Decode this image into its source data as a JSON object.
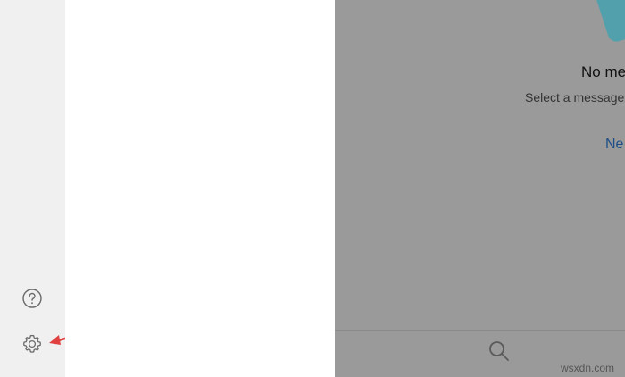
{
  "left_rail": {
    "help_icon": "help-circle-icon",
    "settings_icon": "gear-icon"
  },
  "message_pane": {
    "empty_title": "No mes",
    "empty_subtitle": "Select a message",
    "new_link": "Ne",
    "search_icon": "search-icon"
  },
  "annotation": {
    "arrow_color": "#e04040"
  },
  "watermark": "wsxdn.com",
  "colors": {
    "rail_bg": "#f0f0f0",
    "drawer_bg": "#ffffff",
    "overlay_bg": "#9a9a9a",
    "link": "#1d4f86",
    "illustration": "#53a0ad"
  }
}
